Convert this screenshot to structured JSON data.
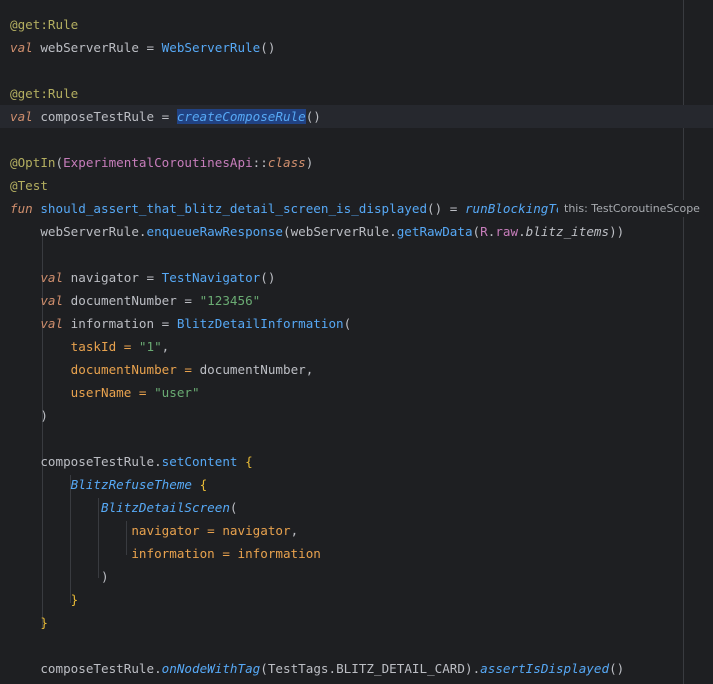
{
  "editor": {
    "language": "Kotlin",
    "inlay_hint": "this: TestCoroutineScope",
    "lines": [
      {
        "text": "@get:Rule"
      },
      {
        "text": "val webServerRule = WebServerRule()"
      },
      {
        "text": ""
      },
      {
        "text": "@get:Rule"
      },
      {
        "text": "val composeTestRule = createComposeRule()"
      },
      {
        "text": ""
      },
      {
        "text": "@OptIn(ExperimentalCoroutinesApi::class)"
      },
      {
        "text": "@Test"
      },
      {
        "text": "fun should_assert_that_blitz_detail_screen_is_displayed() = runBlockingTest {"
      },
      {
        "text": "    webServerRule.enqueueRawResponse(webServerRule.getRawData(R.raw.blitz_items))"
      },
      {
        "text": ""
      },
      {
        "text": "    val navigator = TestNavigator()"
      },
      {
        "text": "    val documentNumber = \"123456\""
      },
      {
        "text": "    val information = BlitzDetailInformation("
      },
      {
        "text": "        taskId = \"1\","
      },
      {
        "text": "        documentNumber = documentNumber,"
      },
      {
        "text": "        userName = \"user\""
      },
      {
        "text": "    )"
      },
      {
        "text": ""
      },
      {
        "text": "    composeTestRule.setContent {"
      },
      {
        "text": "        BlitzRefuseTheme {"
      },
      {
        "text": "            BlitzDetailScreen("
      },
      {
        "text": "                navigator = navigator,"
      },
      {
        "text": "                information = information"
      },
      {
        "text": "            )"
      },
      {
        "text": "        }"
      },
      {
        "text": "    }"
      },
      {
        "text": ""
      },
      {
        "text": "    composeTestRule.onNodeWithTag(TestTags.BLITZ_DETAIL_CARD).assertIsDisplayed()"
      }
    ]
  },
  "tokens": {
    "l0_ann": "@get:Rule",
    "l1_kw": "val",
    "l1_name": " webServerRule = ",
    "l1_call": "WebServerRule",
    "l1_end": "()",
    "l3_ann": "@get:Rule",
    "l4_kw": "val",
    "l4_name": " composeTestRule = ",
    "l4_call": "createComposeRule",
    "l4_end": "()",
    "l6_ann": "@OptIn",
    "l6_open": "(",
    "l6_cls": "ExperimentalCoroutinesApi",
    "l6_sep": "::",
    "l6_kw": "class",
    "l6_close": ")",
    "l7_ann": "@Test",
    "l8_kw": "fun",
    "l8_name": "should_assert_that_blitz_detail_screen_is_displayed",
    "l8_mid": "() = ",
    "l8_call": "runBlockingTest",
    "l8_brace": " {",
    "l9_obj": "webServerRule.",
    "l9_call": "enqueueRawResponse",
    "l9_open": "(webServerRule.",
    "l9_call2": "getRawData",
    "l9_open2": "(",
    "l9_r": "R",
    "l9_dot": ".",
    "l9_raw": "raw",
    "l9_dot2": ".",
    "l9_item": "blitz_items",
    "l9_close": "))",
    "l11_kw": "val",
    "l11_name": " navigator = ",
    "l11_call": "TestNavigator",
    "l11_end": "()",
    "l12_kw": "val",
    "l12_name": " documentNumber = ",
    "l12_str": "\"123456\"",
    "l13_kw": "val",
    "l13_name": " information = ",
    "l13_call": "BlitzDetailInformation",
    "l13_end": "(",
    "l14_arg": "taskId = ",
    "l14_str": "\"1\"",
    "l14_end": ",",
    "l15_arg": "documentNumber = ",
    "l15_val": "documentNumber,",
    "l16_arg": "userName = ",
    "l16_str": "\"user\"",
    "l17_close": ")",
    "l19_obj": "composeTestRule.",
    "l19_call": "setContent",
    "l19_brace": " {",
    "l20_comp": "BlitzRefuseTheme",
    "l20_brace": " {",
    "l21_comp": "BlitzDetailScreen",
    "l21_open": "(",
    "l22_arg": "navigator = ",
    "l22_val": "navigator",
    "l22_end": ",",
    "l23_arg": "information = ",
    "l23_val": "information",
    "l24_close": ")",
    "l25_close": "}",
    "l26_close": "}",
    "l28_obj": "composeTestRule.",
    "l28_call": "onNodeWithTag",
    "l28_open": "(TestTags.",
    "l28_tag": "BLITZ_DETAIL_CARD",
    "l28_mid": ").",
    "l28_call2": "assertIsDisplayed",
    "l28_end": "()"
  },
  "colors": {
    "background": "#1e1f22",
    "current_line": "#26282e",
    "keyword": "#cf8e6d",
    "annotation": "#b3ae60",
    "function": "#56a8f5",
    "string": "#6aab73",
    "property": "#c77dbb",
    "named_argument": "#e8a24e",
    "selection": "#214283"
  }
}
